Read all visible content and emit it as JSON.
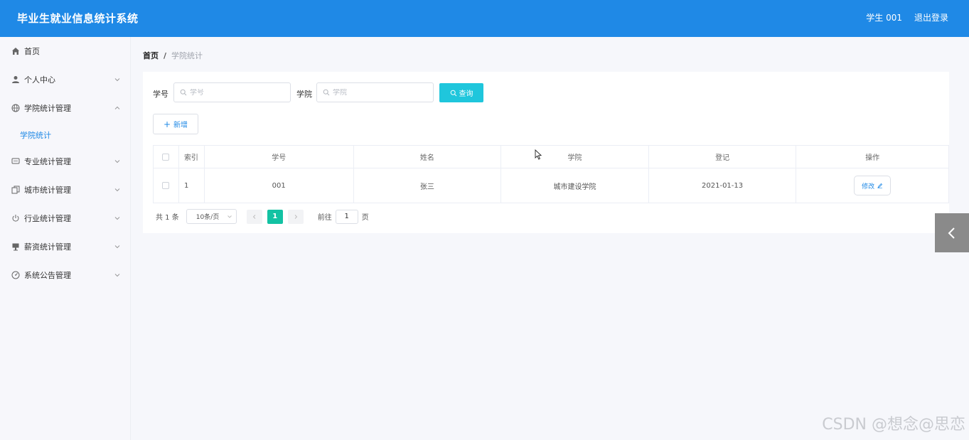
{
  "header": {
    "title": "毕业生就业信息统计系统",
    "user": "学生 001",
    "logout": "退出登录"
  },
  "sidebar": {
    "items": [
      {
        "label": "首页",
        "icon": "home-icon"
      },
      {
        "label": "个人中心",
        "icon": "user-icon"
      },
      {
        "label": "学院统计管理",
        "icon": "globe-icon",
        "expanded": true
      },
      {
        "label": "专业统计管理",
        "icon": "chat-icon"
      },
      {
        "label": "城市统计管理",
        "icon": "copy-icon"
      },
      {
        "label": "行业统计管理",
        "icon": "power-icon"
      },
      {
        "label": "薪资统计管理",
        "icon": "stand-icon"
      },
      {
        "label": "系统公告管理",
        "icon": "gauge-icon"
      }
    ],
    "sub_item": "学院统计"
  },
  "breadcrumb": {
    "home": "首页",
    "sep": "/",
    "current": "学院统计"
  },
  "search": {
    "xuehao_label": "学号",
    "xuehao_placeholder": "学号",
    "xueyuan_label": "学院",
    "xueyuan_placeholder": "学院",
    "button": "查询"
  },
  "toolbar": {
    "add": "新增",
    "add_icon": "+"
  },
  "table": {
    "headers": [
      "索引",
      "学号",
      "姓名",
      "学院",
      "登记",
      "操作"
    ],
    "rows": [
      {
        "index": "1",
        "xuehao": "001",
        "name": "张三",
        "xueyuan": "城市建设学院",
        "date": "2021-01-13",
        "action": "修改"
      }
    ]
  },
  "pagination": {
    "total": "共 1 条",
    "page_size": "10条/页",
    "current": "1",
    "goto_label": "前往",
    "goto_value": "1",
    "page_suffix": "页"
  },
  "watermark": "CSDN @想念@思恋",
  "colors": {
    "header": "#1f89e6",
    "search_button": "#1fc6dc",
    "active_page": "#13c2a3",
    "link": "#1f89e6"
  }
}
